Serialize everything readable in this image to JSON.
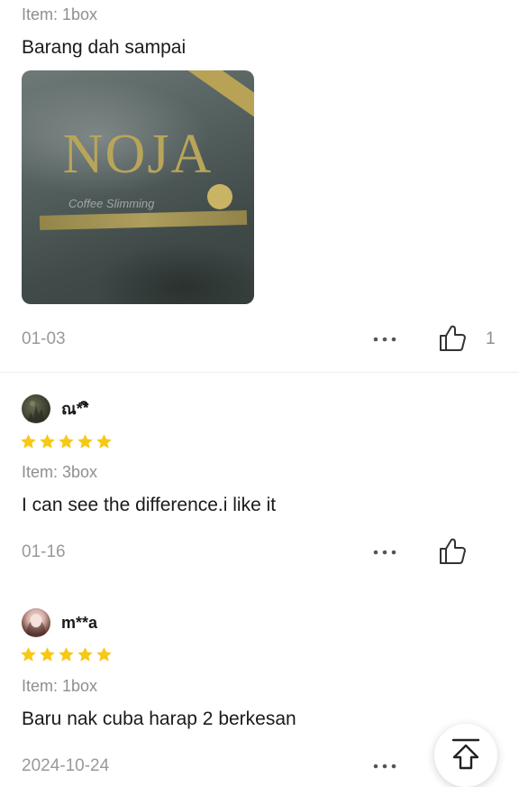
{
  "reviews": [
    {
      "variant": "Item: 1box",
      "text": "Barang dah sampai",
      "photo": {
        "brand_text": "NOJA",
        "subtitle_text": "Coffee Slimming"
      },
      "date": "01-03",
      "like_count": "1"
    },
    {
      "username": "ณ**ิ",
      "rating": 5,
      "variant": "Item: 3box",
      "text": "I can see the difference.i like it",
      "date": "01-16",
      "like_count": ""
    },
    {
      "username": "m**a",
      "rating": 5,
      "variant": "Item: 1box",
      "text": "Baru nak cuba harap 2 berkesan",
      "date": "2024-10-24"
    }
  ],
  "icons": {
    "more": "more-dots-icon",
    "like": "thumbs-up-icon",
    "star": "star-icon",
    "back_to_top": "arrow-up-to-top-icon"
  },
  "colors": {
    "star": "#f7c814",
    "muted_text": "#999999",
    "photo_gold": "#b9a55a"
  }
}
